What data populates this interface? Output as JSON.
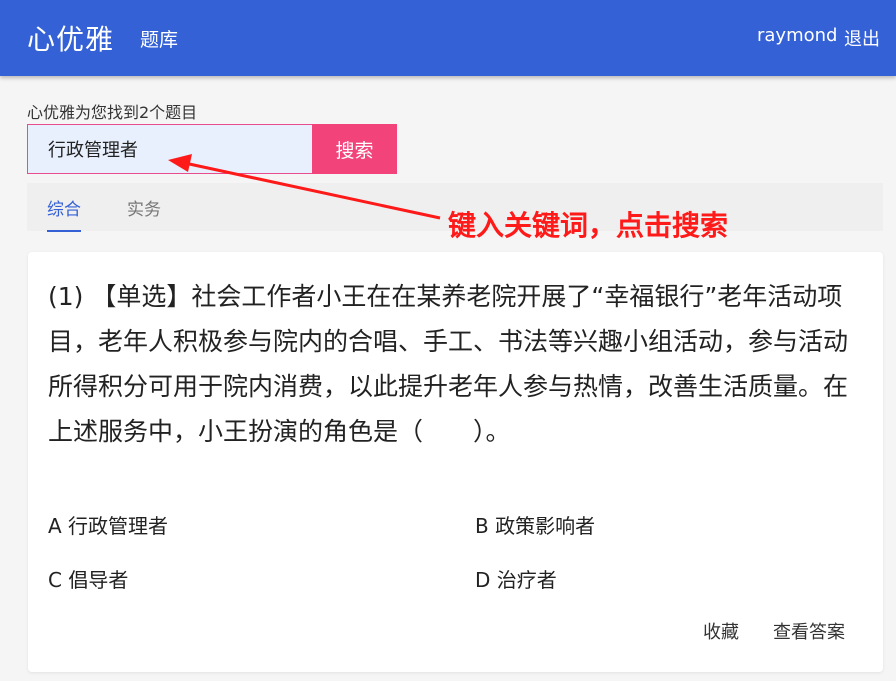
{
  "header": {
    "brand": "心优雅",
    "nav_bank": "题库",
    "username": "raymond",
    "logout": "退出"
  },
  "search": {
    "result_text": "心优雅为您找到2个题目",
    "input_value": "行政管理者",
    "button_label": "搜索"
  },
  "tabs": [
    {
      "label": "综合",
      "active": true
    },
    {
      "label": "实务",
      "active": false
    }
  ],
  "annotation": {
    "text": "键入关键词，点击搜索",
    "color": "#ff1a1a"
  },
  "question": {
    "text": "(1) 【单选】社会工作者小王在在某养老院开展了“幸福银行”老年活动项目，老年人积极参与院内的合唱、手工、书法等兴趣小组活动，参与活动所得积分可用于院内消费，以此提升老年人参与热情，改善生活质量。在上述服务中，小王扮演的角色是（　　）。",
    "options": [
      "A 行政管理者",
      "B 政策影响者",
      "C 倡导者",
      "D 治疗者"
    ],
    "favorite_label": "收藏",
    "view_answer_label": "查看答案"
  },
  "colors": {
    "header_bg": "#3461d6",
    "search_button": "#f2447a",
    "active_tab": "#3461d6"
  }
}
